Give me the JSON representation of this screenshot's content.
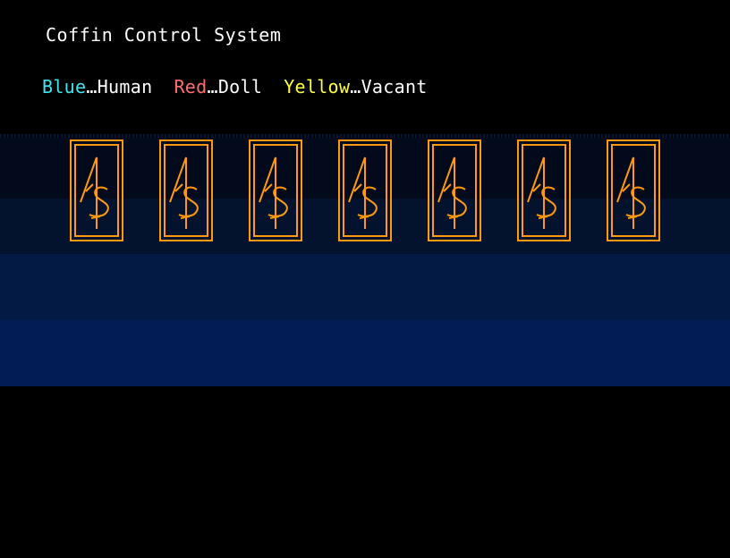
{
  "screen": {
    "title": "Coffin Control System"
  },
  "legend": {
    "items": [
      {
        "color_name": "Blue",
        "separator": "…",
        "meaning": "Human",
        "color": "#3ee6f0"
      },
      {
        "color_name": "Red",
        "separator": "…",
        "meaning": "Doll",
        "color": "#ff6f6f"
      },
      {
        "color_name": "Yellow",
        "separator": "…",
        "meaning": "Vacant",
        "color": "#ffff3c"
      }
    ]
  },
  "coffins": [
    {
      "status": "Vacant",
      "icon": "as-emblem-icon",
      "color": "#ff9a10"
    },
    {
      "status": "Vacant",
      "icon": "as-emblem-icon",
      "color": "#ff9a10"
    },
    {
      "status": "Vacant",
      "icon": "as-emblem-icon",
      "color": "#ff9a10"
    },
    {
      "status": "Vacant",
      "icon": "as-emblem-icon",
      "color": "#ff9a10"
    },
    {
      "status": "Vacant",
      "icon": "as-emblem-icon",
      "color": "#ff9a10"
    },
    {
      "status": "Vacant",
      "icon": "as-emblem-icon",
      "color": "#ff9a10"
    },
    {
      "status": "Vacant",
      "icon": "as-emblem-icon",
      "color": "#ff9a10"
    }
  ]
}
